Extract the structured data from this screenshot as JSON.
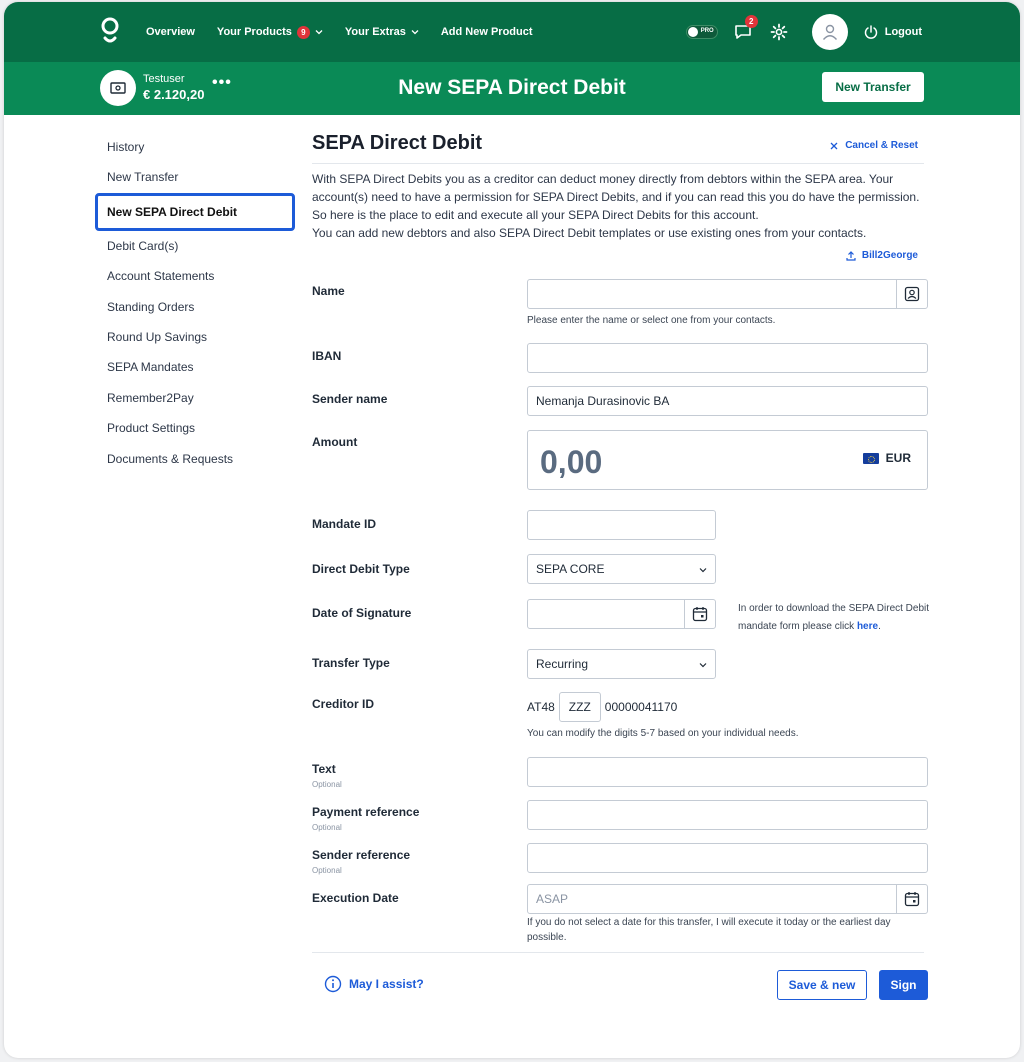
{
  "nav": {
    "overview": "Overview",
    "your_products": "Your Products",
    "products_count": "9",
    "your_extras": "Your Extras",
    "add_new_product": "Add New Product",
    "pro_label": "PRO",
    "messages_count": "2",
    "logout": "Logout"
  },
  "account": {
    "name": "Testuser",
    "balance": "€ 2.120,20",
    "more": "•••"
  },
  "header": {
    "title": "New SEPA Direct Debit",
    "new_transfer": "New Transfer"
  },
  "sidebar": {
    "items": [
      {
        "label": "History"
      },
      {
        "label": "New Transfer"
      },
      {
        "label": "New SEPA Direct Debit"
      },
      {
        "label": "Debit Card(s)"
      },
      {
        "label": "Account Statements"
      },
      {
        "label": "Standing Orders"
      },
      {
        "label": "Round Up Savings"
      },
      {
        "label": "SEPA Mandates"
      },
      {
        "label": "Remember2Pay"
      },
      {
        "label": "Product Settings"
      },
      {
        "label": "Documents & Requests"
      }
    ]
  },
  "form": {
    "title": "SEPA Direct Debit",
    "cancel_reset": "Cancel & Reset",
    "intro_1": "With SEPA Direct Debits you as a creditor can deduct money directly from debtors within the SEPA area. Your account(s) need to have a permission for SEPA Direct Debits, and if you can read this you do have the permission. So here is the place to edit and execute all your SEPA Direct Debits for this account.",
    "intro_2": "You can add new debtors and also SEPA Direct Debit templates or use existing ones from your contacts.",
    "bill2george": "Bill2George",
    "name_label": "Name",
    "name_value": "",
    "name_hint": "Please enter the name or select one from your contacts.",
    "iban_label": "IBAN",
    "iban_value": "",
    "sender_name_label": "Sender name",
    "sender_name_value": "Nemanja Durasinovic BA",
    "amount_label": "Amount",
    "amount_value": "0,00",
    "currency": "EUR",
    "mandate_label": "Mandate ID",
    "mandate_value": "",
    "dd_type_label": "Direct Debit Type",
    "dd_type_value": "SEPA CORE",
    "sig_date_label": "Date of Signature",
    "sig_date_value": "",
    "sig_note": "In order to download the SEPA Direct Debit mandate form please click",
    "sig_note_link": "here",
    "transfer_type_label": "Transfer Type",
    "transfer_type_value": "Recurring",
    "creditor_label": "Creditor ID",
    "creditor_prefix": "AT48",
    "creditor_mid": "ZZZ",
    "creditor_suffix": "00000041170",
    "creditor_hint": "You can modify the digits 5-7 based on your individual needs.",
    "text_label": "Text",
    "optional": "Optional",
    "payment_ref_label": "Payment reference",
    "sender_ref_label": "Sender reference",
    "exec_date_label": "Execution Date",
    "exec_date_placeholder": "ASAP",
    "exec_hint": "If you do not select a date for this transfer, I will execute it today or the earliest day possible.",
    "assist": "May I assist?",
    "save_new": "Save & new",
    "sign": "Sign"
  },
  "colors": {
    "nav_green": "#076d45",
    "subheader_green": "#0a8a56",
    "accent_blue": "#1d5bd8",
    "badge_red": "#e0343a"
  }
}
